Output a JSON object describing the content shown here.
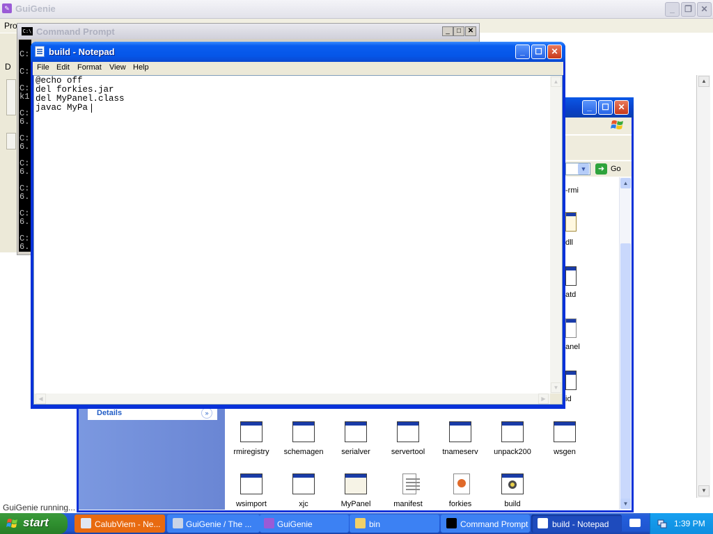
{
  "guigenie": {
    "title": "GuiGenie",
    "menu_partial": "Pro",
    "tab_partial": "D",
    "status": "GuiGenie running..."
  },
  "command_prompt": {
    "title": "Command Prompt",
    "icon_text": "C:\\",
    "visible_lines": [
      "C:",
      "C:",
      "C:",
      "k1",
      "C:",
      "6.",
      "C:",
      "6.",
      "C:",
      "6.",
      "C:",
      "6.",
      "C:",
      "6.",
      "C:",
      "6."
    ]
  },
  "notepad": {
    "title": "build - Notepad",
    "menu": [
      "File",
      "Edit",
      "Format",
      "View",
      "Help"
    ],
    "content": "@echo off\ndel forkies.jar\ndel MyPanel.class\njavac MyPa"
  },
  "explorer": {
    "go_label": "Go",
    "details_label": "Details",
    "partial_labels": [
      "-rmi",
      "dll",
      "atd",
      "anel",
      "id"
    ],
    "files": [
      {
        "name": "rmiregistry",
        "icon": "exe-window-icon"
      },
      {
        "name": "schemagen",
        "icon": "exe-window-icon"
      },
      {
        "name": "serialver",
        "icon": "exe-window-icon"
      },
      {
        "name": "servertool",
        "icon": "exe-window-icon"
      },
      {
        "name": "tnameserv",
        "icon": "exe-window-icon"
      },
      {
        "name": "unpack200",
        "icon": "exe-window-icon"
      },
      {
        "name": "wsgen",
        "icon": "exe-window-icon"
      },
      {
        "name": "wsimport",
        "icon": "exe-window-icon"
      },
      {
        "name": "xjc",
        "icon": "exe-window-icon"
      },
      {
        "name": "MyPanel",
        "icon": "java-source-icon"
      },
      {
        "name": "manifest",
        "icon": "text-file-icon"
      },
      {
        "name": "forkies",
        "icon": "jar-file-icon"
      },
      {
        "name": "build",
        "icon": "batch-file-icon"
      }
    ]
  },
  "taskbar": {
    "start_label": "start",
    "tasks": [
      {
        "label": "CalubViem - Ne...",
        "icon": "browser-icon"
      },
      {
        "label": "GuiGenie / The ...",
        "icon": "eye-icon"
      },
      {
        "label": "GuiGenie",
        "icon": "guigenie-icon"
      },
      {
        "label": "bin",
        "icon": "folder-icon"
      },
      {
        "label": "Command Prompt",
        "icon": "cmd-icon"
      },
      {
        "label": "build - Notepad",
        "icon": "notepad-icon"
      }
    ],
    "clock": "1:39 PM"
  },
  "colors": {
    "xp_blue": "#0831d9",
    "taskbar_blue": "#245edb",
    "start_green": "#2f8f2f",
    "active_task": "#1e4bbd",
    "tray_blue": "#0f8ee0"
  }
}
